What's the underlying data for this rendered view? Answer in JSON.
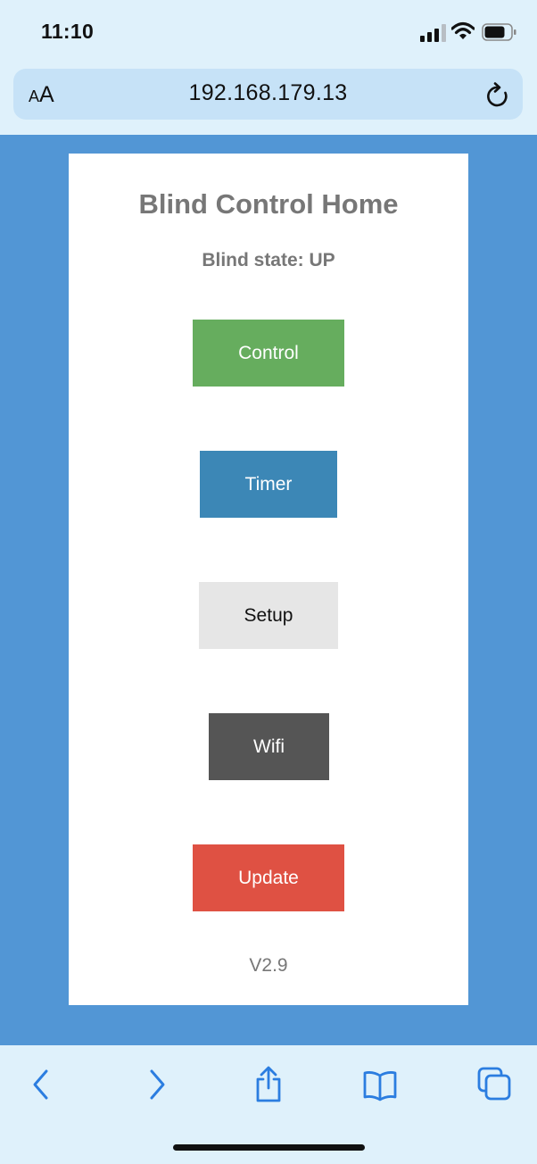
{
  "status_bar": {
    "time": "11:10",
    "signal_icon": "cellular-signal-icon",
    "wifi_icon": "wifi-icon",
    "battery_icon": "battery-icon"
  },
  "address_bar": {
    "text_size_small": "A",
    "text_size_large": "A",
    "url": "192.168.179.13",
    "reload_icon": "reload-icon"
  },
  "page": {
    "title": "Blind Control Home",
    "blind_state": "Blind state: UP",
    "buttons": {
      "control": "Control",
      "timer": "Timer",
      "setup": "Setup",
      "wifi": "Wifi",
      "update": "Update"
    },
    "version": "V2.9"
  },
  "toolbar": {
    "icons": [
      "back-chevron-icon",
      "forward-chevron-icon",
      "share-icon",
      "bookmarks-icon",
      "tabs-icon"
    ]
  },
  "colors": {
    "viewport_bg": "#5296d5",
    "chrome_bg": "#dff1fb",
    "address_bar_bg": "#c6e2f7",
    "control": "#66ad5e",
    "timer": "#3c87b6",
    "setup": "#e6e6e6",
    "wifi": "#555555",
    "update": "#df5143",
    "toolbar_icon": "#2b7de0",
    "heading_text": "#777777"
  }
}
